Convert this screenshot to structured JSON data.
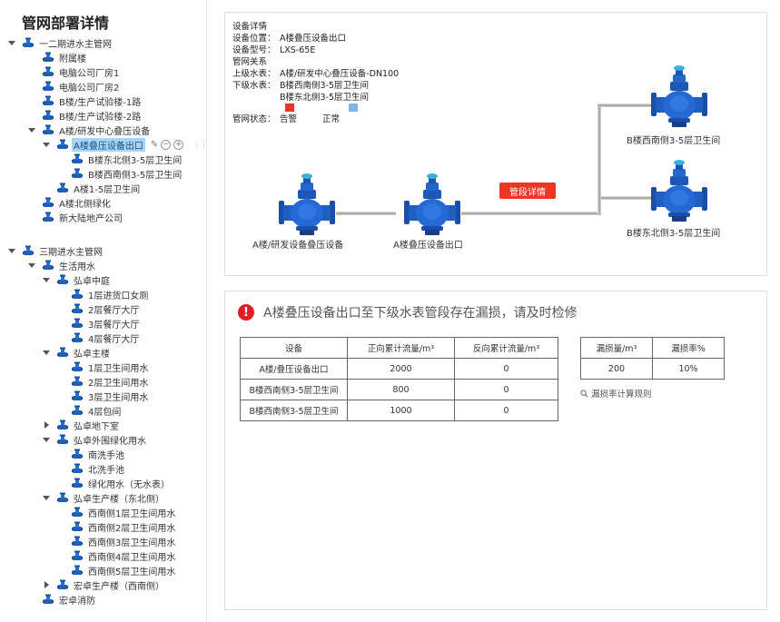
{
  "sidebar": {
    "title": "管网部署详情",
    "tree": [
      {
        "label": "一二期进水主管网",
        "arrow": "down",
        "selected": false
      },
      {
        "label": "附属楼",
        "arrow": "none",
        "selected": false
      },
      {
        "label": "电脑公司厂房1",
        "arrow": "none",
        "selected": false
      },
      {
        "label": "电脑公司厂房2",
        "arrow": "none",
        "selected": false
      },
      {
        "label": "B楼/生产试验楼-1路",
        "arrow": "none",
        "selected": false
      },
      {
        "label": "B楼/生产试验楼-2路",
        "arrow": "none",
        "selected": false
      },
      {
        "label": "A楼/研发中心叠压设备",
        "arrow": "down",
        "selected": false
      },
      {
        "label": "A楼叠压设备出口",
        "arrow": "down",
        "selected": true
      },
      {
        "label": "B楼东北侧3-5层卫生间",
        "arrow": "none",
        "selected": false
      },
      {
        "label": "B楼西南侧3-5层卫生间",
        "arrow": "none",
        "selected": false
      },
      {
        "label": "A楼1-5层卫生间",
        "arrow": "none",
        "selected": false
      },
      {
        "label": "A楼北侧绿化",
        "arrow": "none",
        "selected": false
      },
      {
        "label": "新大陆地产公司",
        "arrow": "none",
        "selected": false
      },
      {
        "label": "三期进水主管网",
        "arrow": "down",
        "selected": false
      },
      {
        "label": "生活用水",
        "arrow": "down",
        "selected": false
      },
      {
        "label": "弘卓中庭",
        "arrow": "down",
        "selected": false
      },
      {
        "label": "1层进货口女厕",
        "arrow": "none",
        "selected": false
      },
      {
        "label": "2层餐厅大厅",
        "arrow": "none",
        "selected": false
      },
      {
        "label": "3层餐厅大厅",
        "arrow": "none",
        "selected": false
      },
      {
        "label": "4层餐厅大厅",
        "arrow": "none",
        "selected": false
      },
      {
        "label": "弘卓主楼",
        "arrow": "down",
        "selected": false
      },
      {
        "label": "1层卫生间用水",
        "arrow": "none",
        "selected": false
      },
      {
        "label": "2层卫生间用水",
        "arrow": "none",
        "selected": false
      },
      {
        "label": "3层卫生间用水",
        "arrow": "none",
        "selected": false
      },
      {
        "label": "4层包间",
        "arrow": "none",
        "selected": false
      },
      {
        "label": "弘卓地下室",
        "arrow": "right",
        "selected": false
      },
      {
        "label": "弘卓外围绿化用水",
        "arrow": "down",
        "selected": false
      },
      {
        "label": "南洗手池",
        "arrow": "none",
        "selected": false
      },
      {
        "label": "北洗手池",
        "arrow": "none",
        "selected": false
      },
      {
        "label": "绿化用水（无水表）",
        "arrow": "none",
        "selected": false
      },
      {
        "label": "弘卓生产楼（东北侧）",
        "arrow": "down",
        "selected": false
      },
      {
        "label": "西南侧1层卫生间用水",
        "arrow": "none",
        "selected": false
      },
      {
        "label": "西南侧2层卫生间用水",
        "arrow": "none",
        "selected": false
      },
      {
        "label": "西南侧3层卫生间用水",
        "arrow": "none",
        "selected": false
      },
      {
        "label": "西南侧4层卫生间用水",
        "arrow": "none",
        "selected": false
      },
      {
        "label": "西南侧5层卫生间用水",
        "arrow": "none",
        "selected": false
      },
      {
        "label": "宏卓生产楼（西南侧）",
        "arrow": "right",
        "selected": false
      },
      {
        "label": "宏卓消防",
        "arrow": "none",
        "selected": false
      }
    ]
  },
  "info": {
    "heading": "设备详情",
    "location_key": "设备位置：",
    "location_val": "A楼叠压设备出口",
    "model_key": "设备型号：",
    "model_val": "LXS-65E",
    "relation": "管网关系",
    "upper_key": "上级水表：",
    "upper_val": "A楼/研发中心叠压设备-DN100",
    "lower_key": "下级水表：",
    "lower_val1": "B楼西南侧3-5层卫生间",
    "lower_val2": "B楼东北侧3-5层卫生间",
    "status_key": "管网状态：",
    "status_alarm": "告警",
    "status_normal": "正常",
    "alarm_color": "#f03524",
    "normal_color": "#7fb6e8"
  },
  "diagram": {
    "dev1_label": "A楼/研发设备叠压设备",
    "dev2_label": "A楼叠压设备出口",
    "dev3_label": "B楼西南侧3-5层卫生间",
    "dev4_label": "B楼东北侧3-5层卫生间",
    "detail_button": "管段详情"
  },
  "alert": {
    "icon": "!",
    "text": "A楼叠压设备出口至下级水表管段存在漏损，请及时检修"
  },
  "flow_table": {
    "headers": [
      "设备",
      "正向累计流量/m³",
      "反向累计流量/m³"
    ],
    "rows": [
      [
        "A楼/叠压设备出口",
        "2000",
        "0"
      ],
      [
        "B楼西南侧3-5层卫生间",
        "800",
        "0"
      ],
      [
        "B楼西南侧3-5层卫生间",
        "1000",
        "0"
      ]
    ]
  },
  "leak_table": {
    "headers": [
      "漏损量/m³",
      "漏损率%"
    ],
    "values": [
      "200",
      "10%"
    ]
  },
  "rule_link": "漏损率计算规则"
}
